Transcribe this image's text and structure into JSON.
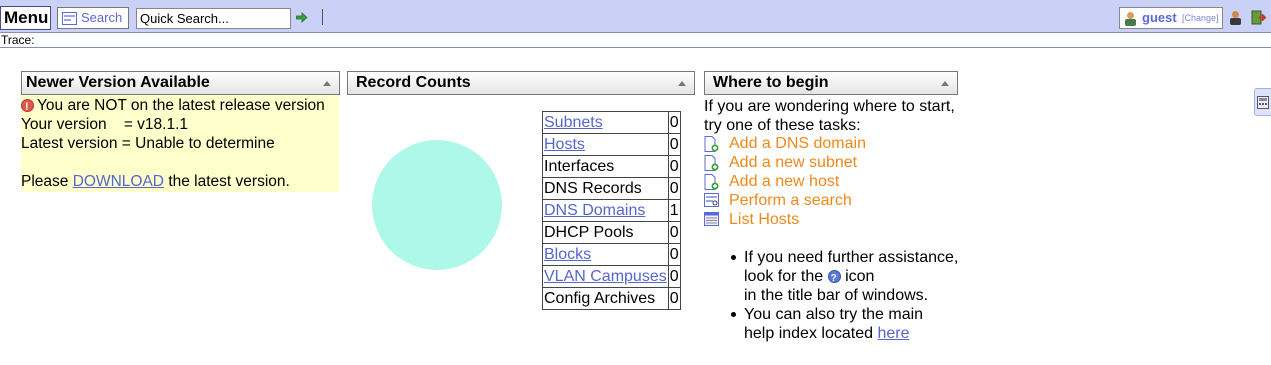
{
  "topbar": {
    "menu_label": "Menu",
    "search_label": "Search",
    "quick_search_value": "Quick Search...",
    "user_name": "guest",
    "user_change": "[Change]"
  },
  "trace_label": "Trace:",
  "newer_version": {
    "title": "Newer Version Available",
    "warning": "You are NOT on the latest release version",
    "your_version": "Your version    = v18.1.1",
    "latest_version": "Latest version = Unable to determine",
    "please": "Please",
    "download_link": "DOWNLOAD",
    "after": "the latest version."
  },
  "record_counts": {
    "title": "Record Counts",
    "rows": [
      {
        "name": "Subnets",
        "value": "0",
        "link": true
      },
      {
        "name": "Hosts",
        "value": "0",
        "link": true
      },
      {
        "name": "Interfaces",
        "value": "0",
        "link": false
      },
      {
        "name": "DNS Records",
        "value": "0",
        "link": false
      },
      {
        "name": "DNS Domains",
        "value": "1",
        "link": true
      },
      {
        "name": "DHCP Pools",
        "value": "0",
        "link": false
      },
      {
        "name": "Blocks",
        "value": "0",
        "link": true
      },
      {
        "name": "VLAN Campuses",
        "value": "0",
        "link": true
      },
      {
        "name": "Config Archives",
        "value": "0",
        "link": false
      }
    ],
    "pie_color": "#adf8e8"
  },
  "where_to_begin": {
    "title": "Where to begin",
    "intro_line1": "If you are wondering where to start,",
    "intro_line2": "try one of these tasks:",
    "tasks": [
      {
        "label": "Add a DNS domain",
        "icon": "add-document-icon"
      },
      {
        "label": "Add a new subnet",
        "icon": "add-document-icon"
      },
      {
        "label": "Add a new host",
        "icon": "add-document-icon"
      },
      {
        "label": "Perform a search",
        "icon": "search-form-icon"
      },
      {
        "label": "List Hosts",
        "icon": "list-table-icon"
      }
    ],
    "bullet1_line1": "If you need further assistance,",
    "bullet1_line2a": "look for the",
    "bullet1_line2b": "icon",
    "bullet1_line3": "in the title bar of windows.",
    "bullet2_line1": "You can also try the main",
    "bullet2_line2": "help index located",
    "here_link": "here"
  },
  "colors": {
    "topbar_bg": "#c9d1f7",
    "link": "#5566cc",
    "task_link": "#f0881a",
    "notice_bg": "#ffffcc"
  }
}
